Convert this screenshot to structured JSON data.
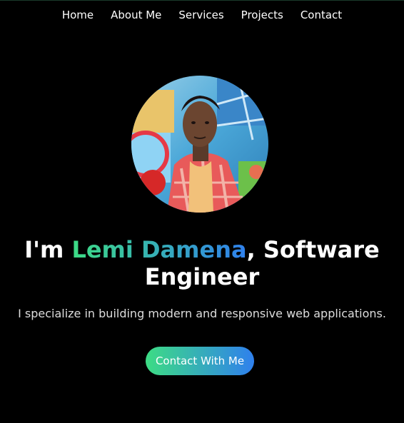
{
  "nav": {
    "items": [
      {
        "label": "Home"
      },
      {
        "label": "About Me"
      },
      {
        "label": "Services"
      },
      {
        "label": "Projects"
      },
      {
        "label": "Contact"
      }
    ]
  },
  "hero": {
    "headline_prefix": "I'm ",
    "name": "Lemi Damena",
    "headline_suffix": ", Software Engineer",
    "subtitle": "I specialize in building modern and responsive web applications.",
    "cta_label": "Contact With Me",
    "avatar_alt": "Profile photo"
  },
  "colors": {
    "background": "#000000",
    "text": "#ffffff",
    "gradient_start": "#3ddc84",
    "gradient_end": "#2f80ed"
  }
}
